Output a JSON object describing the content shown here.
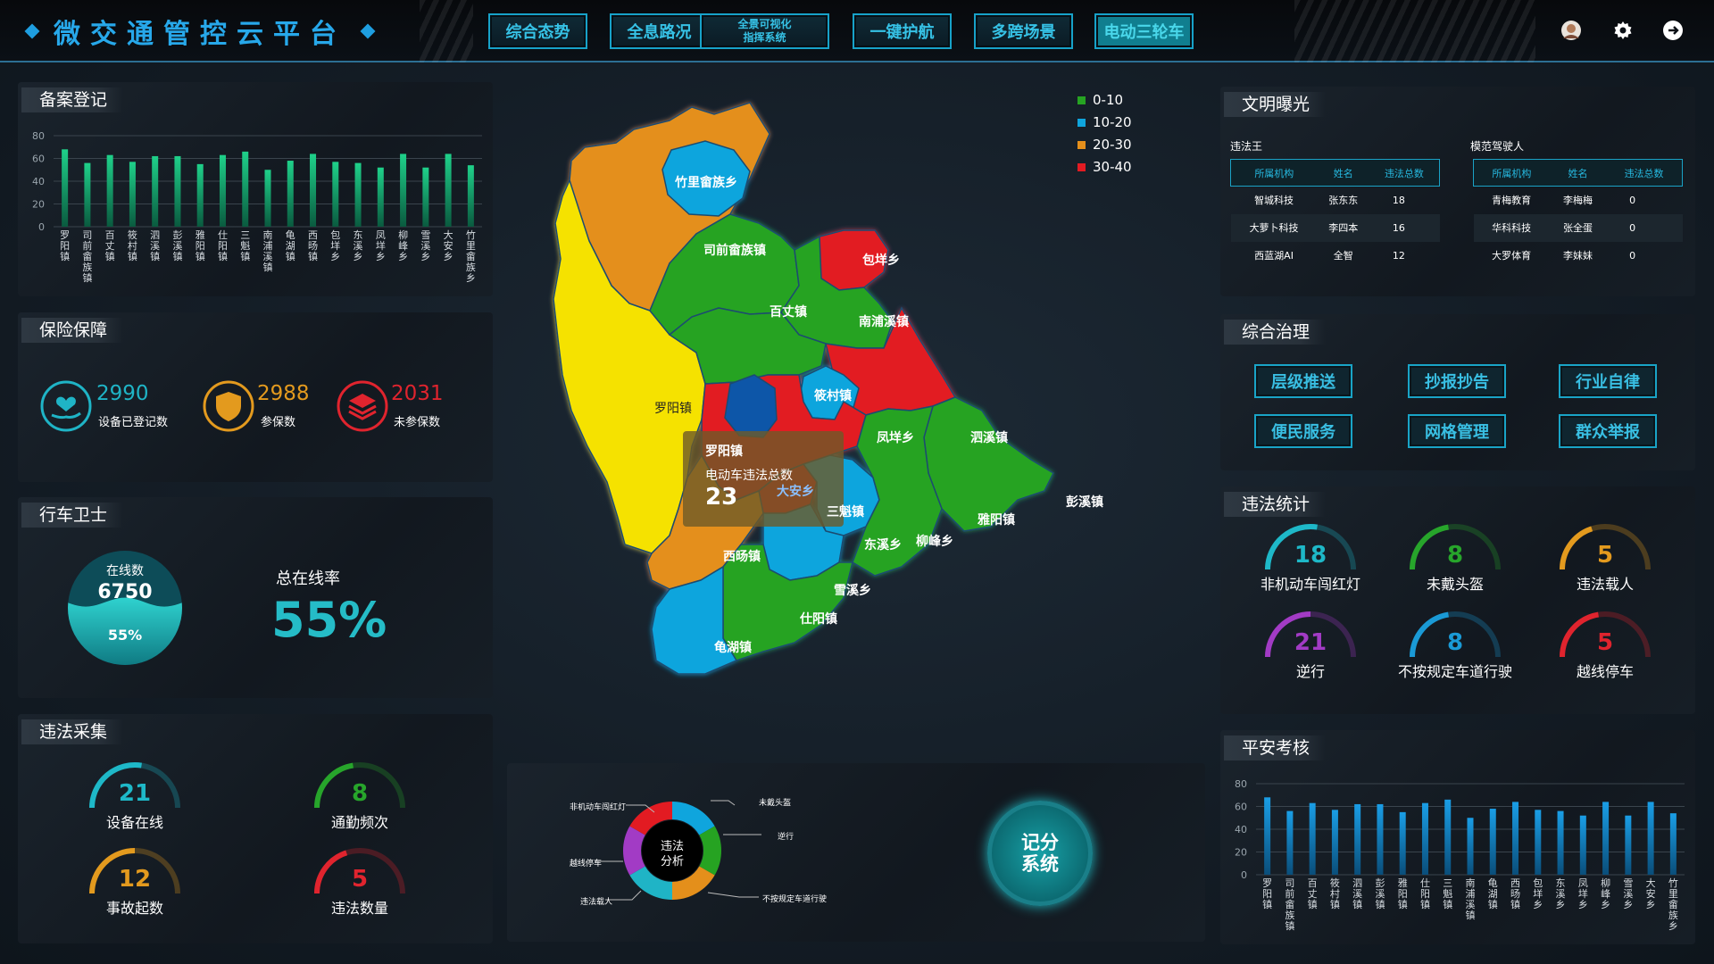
{
  "header": {
    "title": "微交通管控云平台",
    "nav": [
      "综合态势",
      "全息路况",
      "全景可视化指挥系统",
      "一键护航",
      "多跨场景",
      "电动三轮车"
    ],
    "nav_small_line1": "全景可视化",
    "nav_small_line2": "指挥系统"
  },
  "towns": [
    "罗阳镇",
    "司前畲族镇",
    "百丈镇",
    "筱村镇",
    "泗溪镇",
    "彭溪镇",
    "雅阳镇",
    "仕阳镇",
    "三魁镇",
    "南浦溪镇",
    "龟湖镇",
    "西旸镇",
    "包垟乡",
    "东溪乡",
    "凤垟乡",
    "柳峰乡",
    "雪溪乡",
    "大安乡",
    "竹里畲族乡"
  ],
  "registration": {
    "title": "备案登记",
    "yticks": [
      "80",
      "60",
      "40",
      "20",
      "0"
    ],
    "chart_data": {
      "type": "bar",
      "categories": [
        "罗阳镇",
        "司前畲族镇",
        "百丈镇",
        "筱村镇",
        "泗溪镇",
        "彭溪镇",
        "雅阳镇",
        "仕阳镇",
        "三魁镇",
        "南浦溪镇",
        "龟湖镇",
        "西旸镇",
        "包垟乡",
        "东溪乡",
        "凤垟乡",
        "柳峰乡",
        "雪溪乡",
        "大安乡",
        "竹里畲族乡"
      ],
      "values": [
        68,
        56,
        63,
        57,
        62,
        62,
        55,
        63,
        66,
        50,
        58,
        64,
        57,
        56,
        52,
        64,
        52,
        64,
        54
      ],
      "ylim": [
        0,
        80
      ]
    }
  },
  "insurance": {
    "title": "保险保障",
    "items": [
      {
        "value": "2990",
        "label": "设备已登记数",
        "color": "#1fb4c6"
      },
      {
        "value": "2988",
        "label": "参保数",
        "color": "#e39a1e"
      },
      {
        "value": "2031",
        "label": "未参保数",
        "color": "#e0242e"
      }
    ]
  },
  "guard": {
    "title": "行车卫士",
    "online_label": "在线数",
    "online_value": "6750",
    "online_pct": "55%",
    "rate_label": "总在线率",
    "rate_value": "55%",
    "fill_fraction": 0.55
  },
  "collection": {
    "title": "违法采集",
    "items": [
      {
        "value": "21",
        "label": "设备在线",
        "color": "#1eb8c8",
        "fraction": 0.55
      },
      {
        "value": "8",
        "label": "通勤频次",
        "color": "#27a52b",
        "fraction": 0.45
      },
      {
        "value": "12",
        "label": "事故起数",
        "color": "#e39a1e",
        "fraction": 0.5
      },
      {
        "value": "5",
        "label": "违法数量",
        "color": "#e0242e",
        "fraction": 0.4
      }
    ]
  },
  "map": {
    "legend": [
      {
        "label": "0-10",
        "color": "#26a322"
      },
      {
        "label": "10-20",
        "color": "#0fa5dd"
      },
      {
        "label": "20-30",
        "color": "#e48f1b"
      },
      {
        "label": "30-40",
        "color": "#e21b22"
      }
    ],
    "tooltip": {
      "town": "罗阳镇",
      "label": "电动车违法总数",
      "value": "23"
    }
  },
  "analysis": {
    "center_line1": "违法",
    "center_line2": "分析",
    "labels": [
      "非机动车闯红灯",
      "未戴头盔",
      "逆行",
      "越线停车",
      "违法载人",
      "不按规定车道行驶"
    ],
    "score_line1": "记分",
    "score_line2": "系统"
  },
  "civil": {
    "title": "文明曝光",
    "left_title": "违法王",
    "right_title": "模范驾驶人",
    "headers": [
      "所属机构",
      "姓名",
      "违法总数"
    ],
    "left_rows": [
      [
        "智城科技",
        "张东东",
        "18"
      ],
      [
        "大萝卜科技",
        "李四本",
        "16"
      ],
      [
        "西蓝湖AI",
        "全智",
        "12"
      ]
    ],
    "right_rows": [
      [
        "青梅教育",
        "李梅梅",
        "0"
      ],
      [
        "华科科技",
        "张全蛋",
        "0"
      ],
      [
        "大罗体育",
        "李妹妹",
        "0"
      ]
    ]
  },
  "governance": {
    "title": "综合治理",
    "buttons": [
      "层级推送",
      "抄报抄告",
      "行业自律",
      "便民服务",
      "网格管理",
      "群众举报"
    ]
  },
  "violations": {
    "title": "违法统计",
    "items": [
      {
        "value": "18",
        "label": "非机动车闯红灯",
        "color": "#1eb8c8",
        "fraction": 0.55
      },
      {
        "value": "8",
        "label": "未戴头盔",
        "color": "#27a52b",
        "fraction": 0.45
      },
      {
        "value": "5",
        "label": "违法载人",
        "color": "#e39a1e",
        "fraction": 0.4
      },
      {
        "value": "21",
        "label": "逆行",
        "color": "#a23bc5",
        "fraction": 0.5
      },
      {
        "value": "8",
        "label": "不按规定车道行驶",
        "color": "#1a9ad6",
        "fraction": 0.45
      },
      {
        "value": "5",
        "label": "越线停车",
        "color": "#e0242e",
        "fraction": 0.45
      }
    ]
  },
  "safety": {
    "title": "平安考核",
    "yticks": [
      "80",
      "60",
      "40",
      "20",
      "0"
    ],
    "chart_data": {
      "type": "bar",
      "categories": [
        "罗阳镇",
        "司前畲族镇",
        "百丈镇",
        "筱村镇",
        "泗溪镇",
        "彭溪镇",
        "雅阳镇",
        "仕阳镇",
        "三魁镇",
        "南浦溪镇",
        "龟湖镇",
        "西旸镇",
        "包垟乡",
        "东溪乡",
        "凤垟乡",
        "柳峰乡",
        "雪溪乡",
        "大安乡",
        "竹里畲族乡"
      ],
      "values": [
        68,
        56,
        63,
        57,
        62,
        62,
        55,
        63,
        66,
        50,
        58,
        64,
        57,
        56,
        52,
        64,
        52,
        64,
        54
      ],
      "ylim": [
        0,
        80
      ]
    }
  }
}
